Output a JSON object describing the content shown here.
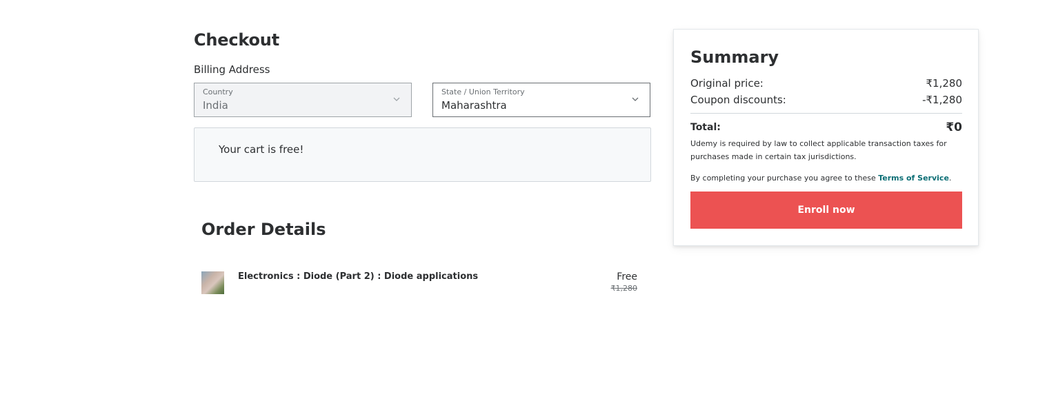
{
  "checkout": {
    "title": "Checkout",
    "billing_label": "Billing Address",
    "country": {
      "label": "Country",
      "value": "India"
    },
    "state": {
      "label": "State / Union Territory",
      "value": "Maharashtra"
    },
    "cart_message": "Your cart is free!"
  },
  "order_details": {
    "title": "Order Details",
    "items": [
      {
        "title": "Electronics : Diode (Part 2) : Diode applications",
        "price": "Free",
        "original_price": "₹1,280"
      }
    ]
  },
  "summary": {
    "title": "Summary",
    "original_price_label": "Original price:",
    "original_price_value": "₹1,280",
    "coupon_label": "Coupon discounts:",
    "coupon_value": "-₹1,280",
    "total_label": "Total:",
    "total_value": "₹0",
    "tax_note": "Udemy is required by law to collect applicable transaction taxes for purchases made in certain tax jurisdictions.",
    "terms_prefix": "By completing your purchase you agree to these ",
    "terms_link": "Terms of Service",
    "terms_suffix": ".",
    "enroll_label": "Enroll now"
  },
  "colors": {
    "enroll_button": "#ec5252",
    "link": "#0b6e75"
  }
}
